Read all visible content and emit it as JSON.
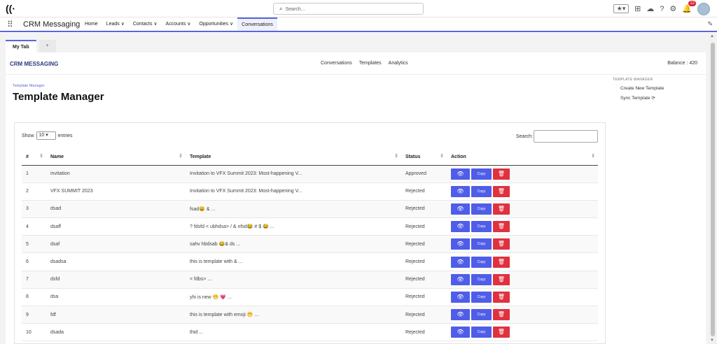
{
  "search": {
    "placeholder": "Search..."
  },
  "header": {
    "notification_count": "12"
  },
  "nav": {
    "app_name": "CRM Messaging",
    "items": [
      {
        "label": "Home"
      },
      {
        "label": "Leads",
        "chevron": "∨"
      },
      {
        "label": "Contacts",
        "chevron": "∨"
      },
      {
        "label": "Accounts",
        "chevron": "∨"
      },
      {
        "label": "Opportunities",
        "chevron": "∨"
      },
      {
        "label": "Conversations",
        "active": true
      }
    ]
  },
  "tabs": {
    "my_tab": "My Tab",
    "add": "+"
  },
  "app": {
    "title": "CRM MESSAGING",
    "center_nav": [
      "Conversations",
      "Templates",
      "Analytics"
    ],
    "balance": "Balance : 420"
  },
  "page": {
    "breadcrumb": "Template Manager",
    "title": "Template Manager"
  },
  "side_panel": {
    "heading": "TEMPLATE MANAGER",
    "create": "Create New Template",
    "sync": "Sync Template"
  },
  "table": {
    "show_label": "Show",
    "entries_value": "10",
    "entries_label": "entries",
    "search_label": "Search:",
    "columns": {
      "num": "#",
      "name": "Name",
      "template": "Template",
      "status": "Status",
      "action": "Action"
    },
    "copy_label": "Copy",
    "rows": [
      {
        "num": "1",
        "name": "invitation",
        "template": "Invitation to VFX Summit 2023: Most-happening V...",
        "status": "Approved"
      },
      {
        "num": "2",
        "name": "VFX SUMMIT 2023",
        "template": "Invitation to VFX Summit 2023: Most-happening V...",
        "status": "Rejected"
      },
      {
        "num": "3",
        "name": "dsad",
        "template": "fsad😀 & ...",
        "status": "Rejected"
      },
      {
        "num": "4",
        "name": "dsaff",
        "template": "? fdsfd < ubhdsa> / & nfsd😂 # $ 😂 ...",
        "status": "Rejected"
      },
      {
        "num": "5",
        "name": "dsaf",
        "template": "sahv hbdsab 😂& ds ...",
        "status": "Rejected"
      },
      {
        "num": "6",
        "name": "dsadsa",
        "template": "this is template with & ...",
        "status": "Rejected"
      },
      {
        "num": "7",
        "name": "dsfd",
        "template": "< fdbs> ...",
        "status": "Rejected"
      },
      {
        "num": "8",
        "name": "dsa",
        "template": "yhi is new 😁 💗 ...",
        "status": "Rejected"
      },
      {
        "num": "9",
        "name": "fdf",
        "template": "this is template with emoji 😁 ...",
        "status": "Rejected"
      },
      {
        "num": "10",
        "name": "dsada",
        "template": "thid ...",
        "status": "Rejected"
      }
    ]
  },
  "colors": {
    "accent": "#5a67d8",
    "button_blue": "#4f5de8",
    "button_red": "#e0313f"
  }
}
